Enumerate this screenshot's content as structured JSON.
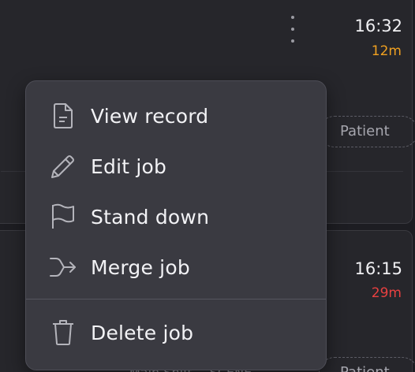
{
  "jobs": [
    {
      "time": "16:32",
      "duration": "12m",
      "tag": "Patient"
    },
    {
      "time": "16:15",
      "duration": "29m",
      "tag": "Patient",
      "meta": [
        "Main Shift",
        "SCENE"
      ]
    }
  ],
  "menu": {
    "items": [
      {
        "label": "View record",
        "icon": "document-icon"
      },
      {
        "label": "Edit job",
        "icon": "pencil-icon"
      },
      {
        "label": "Stand down",
        "icon": "flag-icon"
      },
      {
        "label": "Merge job",
        "icon": "merge-arrow-icon"
      }
    ],
    "danger_items": [
      {
        "label": "Delete job",
        "icon": "trash-icon"
      }
    ]
  },
  "colors": {
    "background": "#1d1d22",
    "card": "#26262b",
    "menu": "#3a3a41",
    "duration_warning": "#f0a020",
    "duration_alert": "#e84040"
  }
}
